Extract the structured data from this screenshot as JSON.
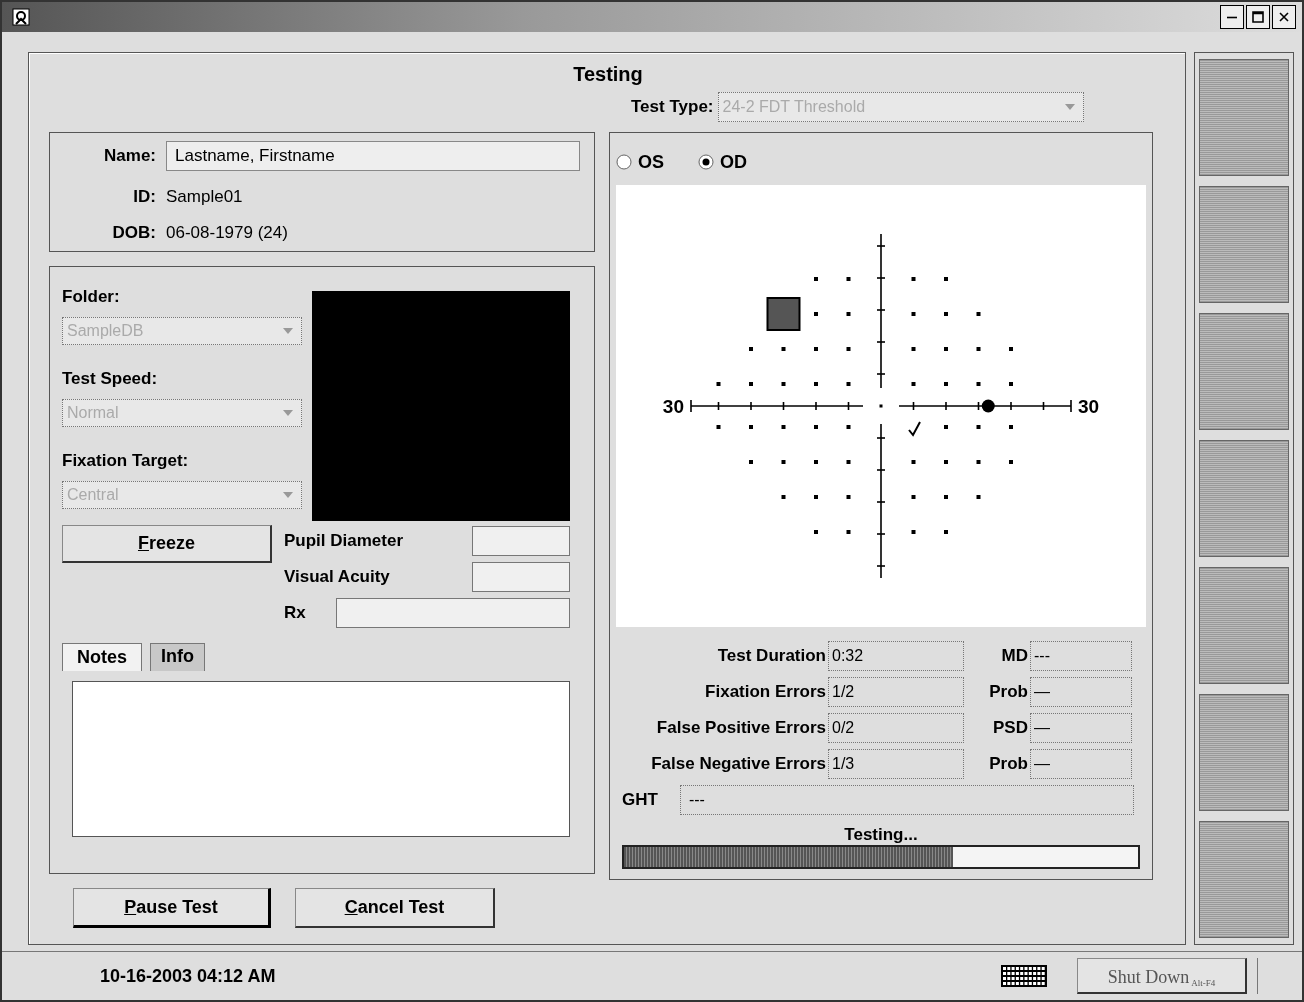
{
  "heading": "Testing",
  "test_type": {
    "label": "Test Type:",
    "value": "24-2 FDT Threshold",
    "disabled": true
  },
  "patient": [
    {
      "label": "Name:",
      "value": "Lastname, Firstname",
      "kind": "field"
    },
    {
      "label": "ID:",
      "value": "Sample01",
      "kind": "text"
    },
    {
      "label": "DOB:",
      "value": "06-08-1979 (24)",
      "kind": "text"
    }
  ],
  "settings": [
    {
      "label": "Folder:",
      "value": "SampleDB",
      "disabled": true
    },
    {
      "label": "Test Speed:",
      "value": "Normal",
      "disabled": true
    },
    {
      "label": "Fixation Target:",
      "value": "Central",
      "disabled": true
    }
  ],
  "freeze_button": {
    "label": "Freeze",
    "mnemonic_underlined": true
  },
  "measurements": [
    {
      "label": "Pupil Diameter",
      "kind": "short"
    },
    {
      "label": "Visual Acuity",
      "kind": "short"
    },
    {
      "label": "Rx",
      "kind": "long"
    }
  ],
  "tabs": [
    {
      "label": "Notes",
      "selected": true
    },
    {
      "label": "Info",
      "selected": false
    }
  ],
  "eye": [
    {
      "label": "OS",
      "selected": false
    },
    {
      "label": "OD",
      "selected": true
    }
  ],
  "field_map": {
    "axis_labels": [
      "30",
      "30"
    ]
  },
  "results": [
    {
      "label": "Test Duration",
      "value": "0:32",
      "index": {
        "label": "MD",
        "value": "---"
      }
    },
    {
      "label": "Fixation Errors",
      "value": "1/2",
      "index": {
        "label": "Prob",
        "value": "—"
      }
    },
    {
      "label": "False Positive Errors",
      "value": "0/2",
      "index": {
        "label": "PSD",
        "value": "—"
      }
    },
    {
      "label": "False Negative Errors",
      "value": "1/3",
      "index": {
        "label": "Prob",
        "value": "—"
      }
    }
  ],
  "ght": {
    "label": "GHT",
    "value": "---"
  },
  "progress": {
    "label": "Testing...",
    "level": 0.64
  },
  "actions": [
    {
      "label": "Pause Test",
      "mnemonic_underlined": true,
      "focused": true
    },
    {
      "label": "Cancel Test",
      "mnemonic_underlined": true,
      "focused": false
    }
  ],
  "sidebar": {
    "buttons": [
      {
        "kind": "blank"
      },
      {
        "kind": "blank"
      },
      {
        "kind": "blank"
      },
      {
        "kind": "blank"
      },
      {
        "kind": "blank"
      },
      {
        "kind": "blank"
      },
      {
        "kind": "blank"
      }
    ]
  },
  "status_bar": {
    "datetime": "10-16-2003 04:12 AM",
    "shutdown": {
      "label": "Shut Down",
      "shortcut": "Alt-F4"
    }
  }
}
